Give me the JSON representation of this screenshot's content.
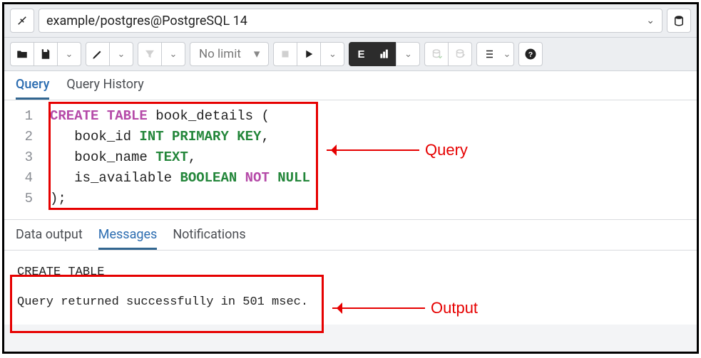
{
  "connection": {
    "label": "example/postgres@PostgreSQL 14"
  },
  "toolbar": {
    "limit_label": "No limit"
  },
  "editor_tabs": {
    "query": "Query",
    "history": "Query History"
  },
  "editor": {
    "lines": [
      "1",
      "2",
      "3",
      "4",
      "5"
    ],
    "code": [
      {
        "segments": [
          {
            "t": "CREATE TABLE",
            "c": "kw-create"
          },
          {
            "t": " book_details (",
            "c": "plain"
          }
        ]
      },
      {
        "segments": [
          {
            "t": "   book_id ",
            "c": "plain"
          },
          {
            "t": "INT PRIMARY KEY",
            "c": "kw-type"
          },
          {
            "t": ",",
            "c": "plain"
          }
        ]
      },
      {
        "segments": [
          {
            "t": "   book_name ",
            "c": "plain"
          },
          {
            "t": "TEXT",
            "c": "kw-type"
          },
          {
            "t": ",",
            "c": "plain"
          }
        ]
      },
      {
        "segments": [
          {
            "t": "   is_available ",
            "c": "plain"
          },
          {
            "t": "BOOLEAN ",
            "c": "kw-type"
          },
          {
            "t": "NOT ",
            "c": "kw-constraint"
          },
          {
            "t": "NULL",
            "c": "kw-type"
          }
        ]
      },
      {
        "segments": [
          {
            "t": ");",
            "c": "plain"
          }
        ]
      }
    ]
  },
  "output_tabs": {
    "data": "Data output",
    "messages": "Messages",
    "notifications": "Notifications"
  },
  "messages": {
    "line1": "CREATE TABLE",
    "line2": "Query returned successfully in 501 msec."
  },
  "annotations": {
    "query": "Query",
    "output": "Output"
  }
}
